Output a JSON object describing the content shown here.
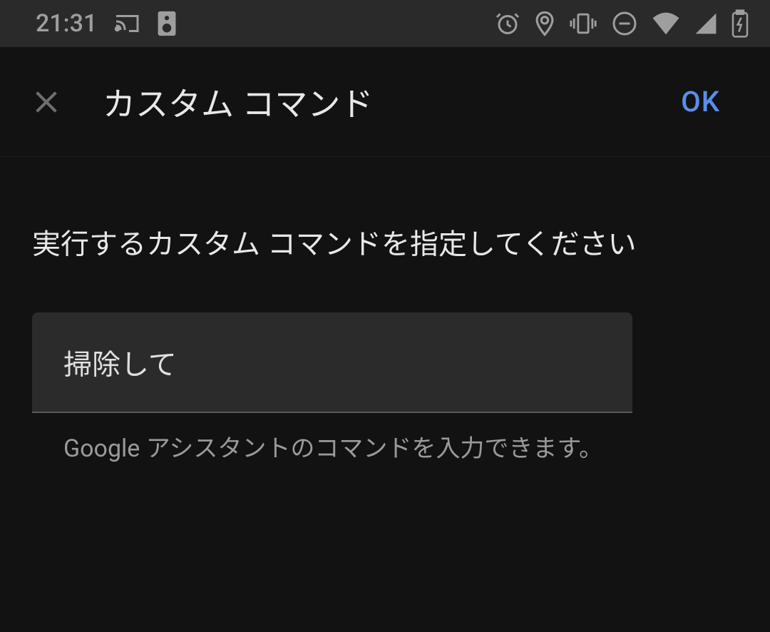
{
  "statusBar": {
    "time": "21:31"
  },
  "appBar": {
    "title": "カスタム コマンド",
    "okLabel": "OK"
  },
  "content": {
    "instruction": "実行するカスタム コマンドを指定してください",
    "inputValue": "掃除して",
    "helperText": "Google アシスタントのコマンドを入力できます。"
  }
}
